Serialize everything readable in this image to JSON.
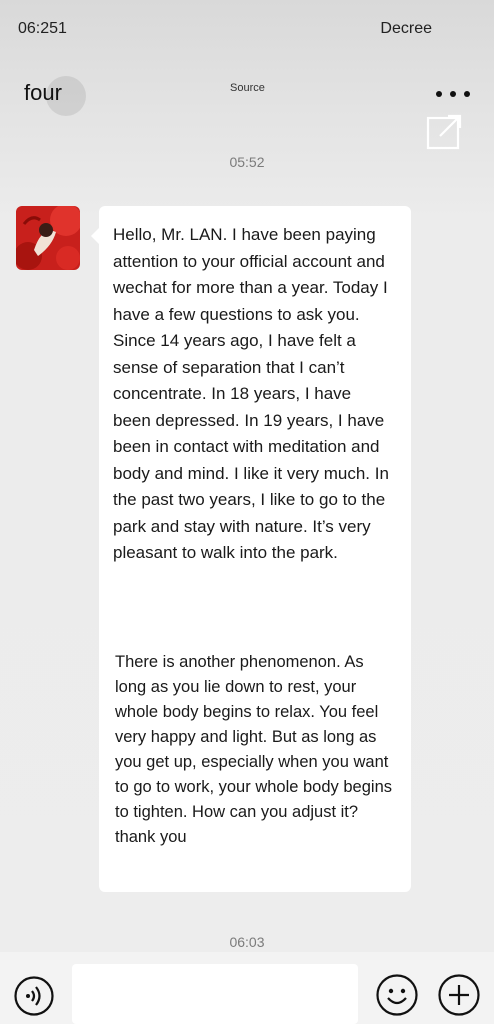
{
  "status_bar": {
    "time": "06:251",
    "right_text": "Decree"
  },
  "header": {
    "title": "four",
    "subtitle": "Source",
    "more_icon": "more-dots-icon",
    "share_icon": "share-external-icon"
  },
  "chat": {
    "timestamps": [
      "05:52",
      "06:03"
    ],
    "messages": [
      {
        "sender": "contact",
        "avatar_icon": "avatar",
        "paragraphs": [
          "Hello, Mr. LAN. I have been paying attention to your official account and wechat for more than a year. Today I have a few questions to ask you. Since 14 years ago, I have felt a sense of separation that I can’t concentrate. In 18 years, I have been depressed. In 19 years, I have been in contact with meditation and body and mind. I like it very much. In the past two years, I like to go to the park and stay with nature. It’s very pleasant to walk into the park.",
          "There is another phenomenon. As long as you lie down to rest, your whole body begins to relax. You feel very happy and light. But as long as you get up, especially when you want to go to work, your whole body begins to tighten. How can you adjust it? thank you"
        ]
      }
    ]
  },
  "input_bar": {
    "voice_icon": "voice-icon",
    "input_value": "",
    "emoji_icon": "emoji-icon",
    "plus_icon": "plus-icon"
  },
  "colors": {
    "background": "#ededed",
    "bubble": "#ffffff",
    "timestamp": "#7b7b7b"
  }
}
